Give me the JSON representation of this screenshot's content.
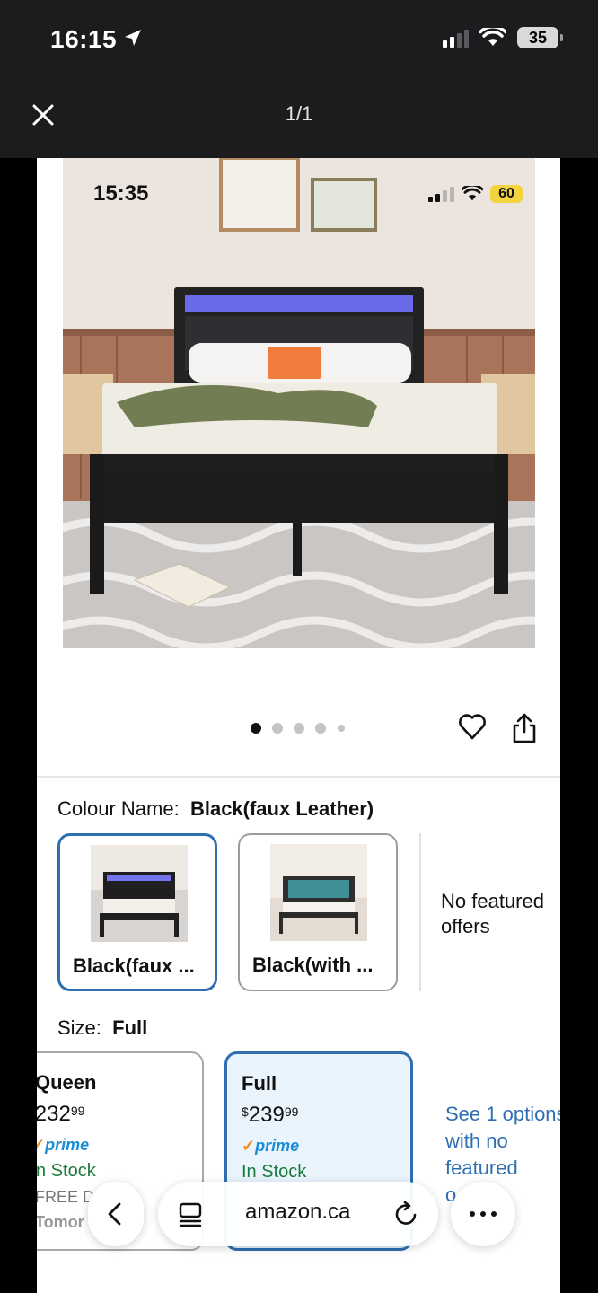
{
  "status_bar": {
    "time": "16:15",
    "battery": "35"
  },
  "viewer": {
    "page_counter": "1/1"
  },
  "inner_status": {
    "time": "15:35",
    "battery": "60"
  },
  "carousel": {
    "total": 5,
    "active": 0
  },
  "colour": {
    "label": "Colour Name:",
    "value": "Black(faux Leather)"
  },
  "swatches": [
    {
      "label": "Black(faux ...",
      "selected": true
    },
    {
      "label": "Black(with ...",
      "selected": false
    }
  ],
  "no_featured": "No featured offers",
  "size": {
    "label": "Size:",
    "value": "Full"
  },
  "size_cards": [
    {
      "name": "Queen",
      "currency": "$",
      "price_main": "232",
      "price_cents": "99",
      "prime": "prime",
      "stock": "n Stock",
      "free": "FREE D",
      "delivery": "Tomor",
      "selected": false
    },
    {
      "name": "Full",
      "currency": "$",
      "price_main": "239",
      "price_cents": "99",
      "prime": "prime",
      "stock": "In Stock",
      "free": "",
      "delivery": "",
      "selected": true
    }
  ],
  "see_options": {
    "line1": "See 1 options",
    "line2": "with no",
    "line3": "featured",
    "line4": "o"
  },
  "browser": {
    "url": "amazon.ca"
  },
  "icons": {
    "location": "location-arrow-icon",
    "close": "close-icon",
    "heart": "heart-icon",
    "share": "share-icon",
    "back": "chevron-left-icon",
    "tabs": "page-menu-icon",
    "reload": "reload-icon",
    "more": "more-icon"
  },
  "colors": {
    "accent": "#2f6fb1",
    "prime": "#1b8fd6",
    "in_stock": "#1a7a3c",
    "selected_bg": "#eaf4fc"
  }
}
